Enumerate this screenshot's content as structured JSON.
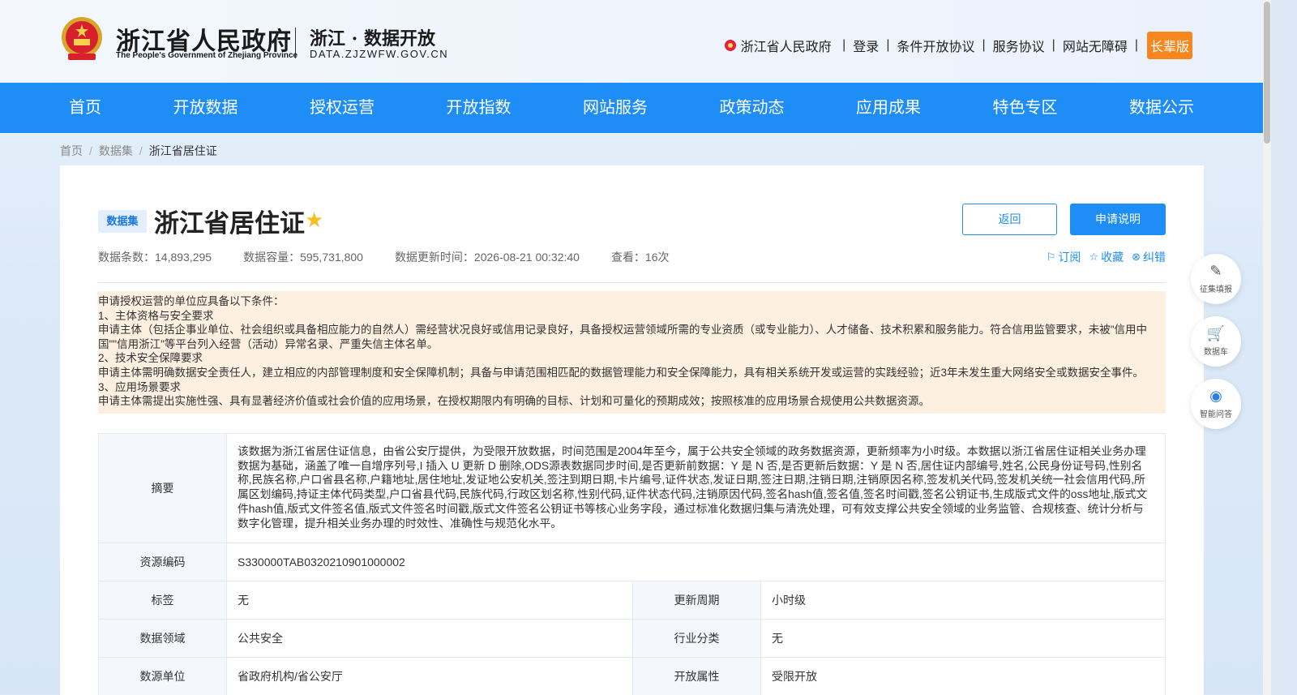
{
  "header": {
    "gov_title": "浙江省人民政府",
    "gov_subtitle": "The People's Government of Zhejiang Province",
    "portal_title": "浙江 · 数据开放",
    "portal_domain": "DATA.ZJZWFW.GOV.CN",
    "links": [
      "浙江省人民政府",
      "登录",
      "条件开放协议",
      "服务协议",
      "网站无障碍"
    ],
    "elder_mode": "长辈版"
  },
  "nav": [
    "首页",
    "开放数据",
    "授权运营",
    "开放指数",
    "网站服务",
    "政策动态",
    "应用成果",
    "特色专区",
    "数据公示"
  ],
  "breadcrumb": [
    "首页",
    "数据集",
    "浙江省居住证"
  ],
  "dataset": {
    "tag": "数据集",
    "title": "浙江省居住证",
    "back_label": "返回",
    "apply_label": "申请说明",
    "meta": {
      "records": "数据条数：14,893,295",
      "capacity": "数据容量：595,731,800",
      "updated": "数据更新时间：2026-08-21 00:32:40",
      "views": "查看：16次"
    },
    "actions": [
      "订阅",
      "收藏",
      "纠错"
    ]
  },
  "notice": [
    "申请授权运营的单位应具备以下条件：",
    "1、主体资格与安全要求",
    "申请主体（包括企事业单位、社会组织或具备相应能力的自然人）需经营状况良好或信用记录良好，具备授权运营领域所需的专业资质（或专业能力）、人才储备、技术积累和服务能力。符合信用监管要求，未被\"信用中国\"\"信用浙江\"等平台列入经营（活动）异常名录、严重失信主体名单。",
    "2、技术安全保障要求",
    "申请主体需明确数据安全责任人，建立相应的内部管理制度和安全保障机制；具备与申请范围相匹配的数据管理能力和安全保障能力，具有相关系统开发或运营的实践经验；近3年未发生重大网络安全或数据安全事件。",
    "3、应用场景要求",
    "申请主体需提出实施性强、具有显著经济价值或社会价值的应用场景，在授权期限内有明确的目标、计划和可量化的预期成效；按照核准的应用场景合规使用公共数据资源。"
  ],
  "info": {
    "summary_label": "摘要",
    "summary": "该数据为浙江省居住证信息，由省公安厅提供，为受限开放数据，时间范围是2004年至今，属于公共安全领域的政务数据资源，更新频率为小时级。本数据以浙江省居住证相关业务办理数据为基础，涵盖了唯一自增序列号,I 插入 U 更新 D 删除,ODS源表数据同步时间,是否更新前数据：Y 是 N 否,是否更新后数据：Y 是 N 否,居住证内部编号,姓名,公民身份证号码,性别名称,民族名称,户口省县名称,户籍地址,居住地址,发证地公安机关,签注到期日期,卡片编号,证件状态,发证日期,签注日期,注销日期,注销原因名称,签发机关代码,签发机关统一社会信用代码,所属区划编码,持证主体代码类型,户口省县代码,民族代码,行政区划名称,性别代码,证件状态代码,注销原因代码,签名hash值,签名值,签名时间戳,签名公钥证书,生成版式文件的oss地址,版式文件hash值,版式文件签名值,版式文件签名时间戳,版式文件签名公钥证书等核心业务字段，通过标准化数据归集与清洗处理，可有效支撑公共安全领域的业务监管、合规核查、统计分析与数字化管理，提升相关业务办理的时效性、准确性与规范化水平。",
    "code_label": "资源编码",
    "code": "S330000TAB0320210901000002",
    "tag_label": "标签",
    "tag": "无",
    "cycle_label": "更新周期",
    "cycle": "小时级",
    "domain_label": "数据领域",
    "domain": "公共安全",
    "industry_label": "行业分类",
    "industry": "无",
    "unit_label": "数源单位",
    "unit": "省政府机构/省公安厅",
    "open_label": "开放属性",
    "open": "受限开放"
  },
  "side": [
    "征集填报",
    "数据车",
    "智能问答"
  ],
  "colors": {
    "primary": "#1e8df5",
    "elder": "#f6871f",
    "notice_bg": "#fdf0e0",
    "star": "#f6c025"
  }
}
